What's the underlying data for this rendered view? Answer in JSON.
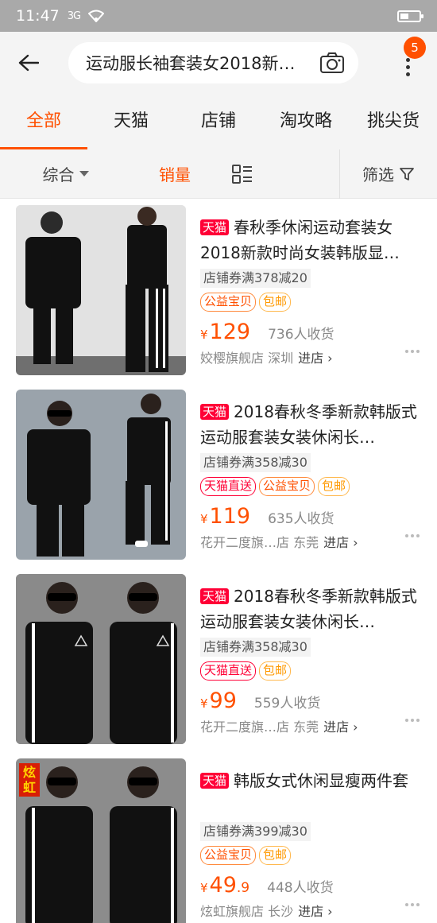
{
  "status_bar": {
    "time": "11:47",
    "signal": "3G",
    "battery_level": 0.45
  },
  "search": {
    "query": "运动服长袖套装女2018新…",
    "badge_count": "5"
  },
  "tabs": [
    {
      "label": "全部",
      "active": true
    },
    {
      "label": "天猫",
      "active": false
    },
    {
      "label": "店铺",
      "active": false
    },
    {
      "label": "淘攻略",
      "active": false
    },
    {
      "label": "挑尖货",
      "active": false
    }
  ],
  "sort": {
    "general": "综合",
    "sales": "销量",
    "filter": "筛选"
  },
  "products": [
    {
      "tm_tag": "天猫",
      "title": "春秋季休闲运动套装女2018新款时尚女装韩版显…",
      "coupon": "店铺券满378减20",
      "tags": [
        "公益宝贝",
        "包邮"
      ],
      "yen": "¥",
      "price": "129",
      "price_dec": "",
      "sold": "736人收货",
      "shop": "姣樱旗舰店 深圳",
      "enter": "进店 ›"
    },
    {
      "tm_tag": "天猫",
      "title": "2018春秋冬季新款韩版式运动服套装女装休闲长…",
      "coupon": "店铺券满358减30",
      "tags": [
        "天猫直送",
        "公益宝贝",
        "包邮"
      ],
      "yen": "¥",
      "price": "119",
      "price_dec": "",
      "sold": "635人收货",
      "shop": "花开二度旗…店 东莞",
      "enter": "进店 ›"
    },
    {
      "tm_tag": "天猫",
      "title": "2018春秋冬季新款韩版式运动服套装女装休闲长…",
      "coupon": "店铺券满358减30",
      "tags": [
        "天猫直送",
        "包邮"
      ],
      "yen": "¥",
      "price": "99",
      "price_dec": "",
      "sold": "559人收货",
      "shop": "花开二度旗…店 东莞",
      "enter": "进店 ›"
    },
    {
      "tm_tag": "天猫",
      "title": "韩版女式休闲显瘦两件套",
      "coupon": "店铺券满399减30",
      "tags": [
        "公益宝贝",
        "包邮"
      ],
      "yen": "¥",
      "price": "49",
      "price_dec": ".9",
      "sold": "448人收货",
      "shop": "炫虹旗舰店 长沙",
      "enter": "进店 ›",
      "brand_mark": "炫虹"
    }
  ]
}
